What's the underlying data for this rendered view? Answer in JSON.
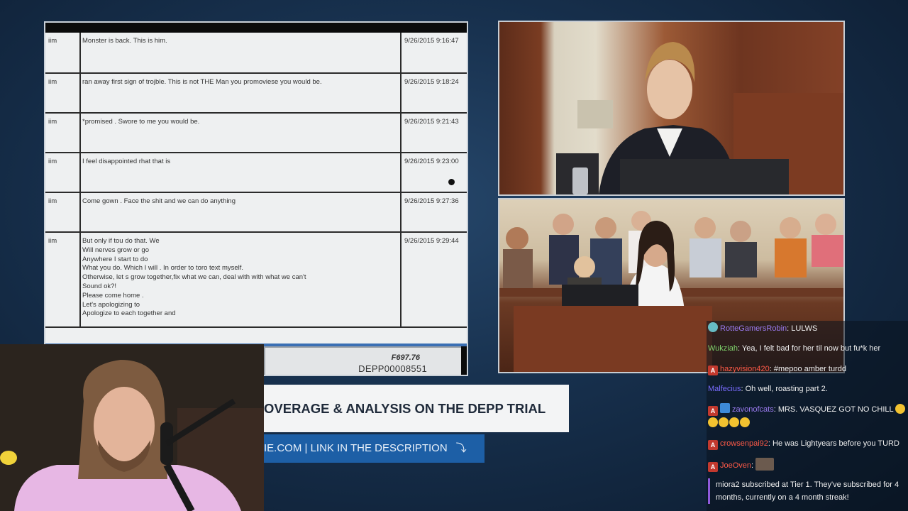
{
  "document": {
    "rows": [
      {
        "sender": "iim",
        "text": "Monster is back. This is him.",
        "time": "9/26/2015 9:16:47"
      },
      {
        "sender": "iim",
        "text": "ran away first sign of trojble. This is not THE Man you promoviese you would be.",
        "time": "9/26/2015 9:18:24"
      },
      {
        "sender": "iim",
        "text": "*promised . Swore to me you would be.",
        "time": "9/26/2015 9:21:43"
      },
      {
        "sender": "iim",
        "text": "I feel disappointed rhat that is",
        "time": "9/26/2015 9:23:00"
      },
      {
        "sender": "iim",
        "text": "Come gown . Face the shit and we can do anything",
        "time": "9/26/2015 9:27:36"
      },
      {
        "sender": "iim",
        "text": "But only if tou do that. We\nWill nerves grow or go\nAnywhere I start to do\nWhat you do. Which I will . In order to toro text myself.\nOtherwise, let s grow together,fix what we can, deal with with what we can't\nSound ok?!\nPlease come home .\nLet's apologizing to\nApologize to each together and",
        "time": "9/26/2015 9:29:44"
      }
    ],
    "exhibit_code": "F697.76",
    "bates_number": "DEPP00008551"
  },
  "banner": {
    "title": "OVERAGE & ANALYSIS ON THE DEPP TRIAL",
    "link": "IE.COM | LINK IN THE DESCRIPTION",
    "arrow": "⤵"
  },
  "chat": {
    "messages": [
      {
        "badge": "teal",
        "user": "RotteGamersRobin",
        "user_color": "#9b7bf0",
        "text": "LULWS"
      },
      {
        "badge": "",
        "user": "Wukziah",
        "user_color": "#7fd36b",
        "text": "Yea, I felt bad for her til now but fu*k her"
      },
      {
        "badge": "red",
        "user": "hazyvision420",
        "user_color": "#ff5a47",
        "text": "#mepoo amber turdd"
      },
      {
        "badge": "",
        "user": "Malfecius",
        "user_color": "#7a6cff",
        "text": "Oh well, roasting part 2."
      },
      {
        "badge": "red+blue",
        "user": "zavonofcats",
        "user_color": "#9b7bf0",
        "text": "MRS. VASQUEZ GOT NO CHILL"
      },
      {
        "badge": "red",
        "user": "crowsenpai92",
        "user_color": "#ff5a47",
        "text": "He was Lightyears before you TURD"
      },
      {
        "badge": "red",
        "user": "JoeOven",
        "user_color": "#ff5a47",
        "text": ""
      }
    ],
    "badge_letter": "A",
    "sub_notice": "miora2 subscribed at Tier 1. They've subscribed for 4 months, currently on a 4 month streak!"
  }
}
